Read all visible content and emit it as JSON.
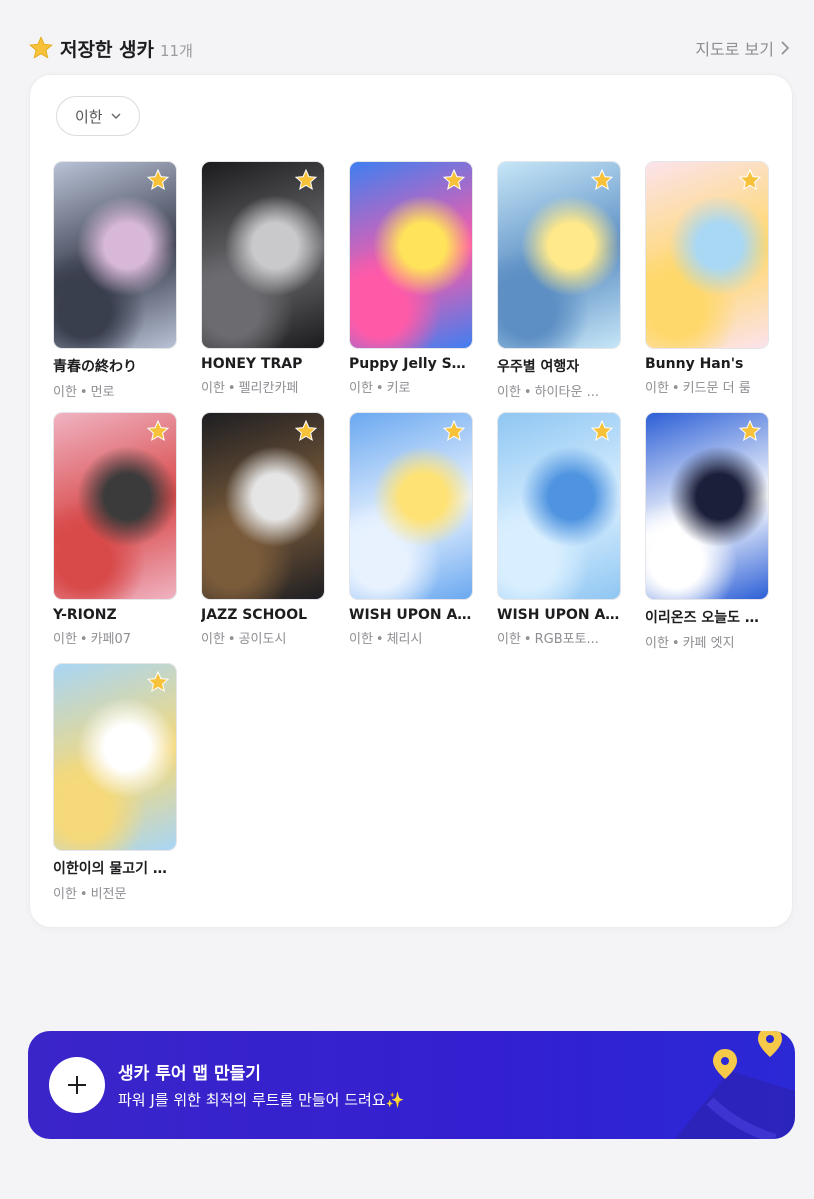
{
  "header": {
    "title": "저장한 생카",
    "count": "11개",
    "map_link": "지도로 보기",
    "icon": "star-icon"
  },
  "filter": {
    "selected": "이한"
  },
  "cards": [
    {
      "title": "青春の終わり",
      "artist": "이한",
      "venue": "먼로",
      "colors": [
        "#b9c2d6",
        "#3a3f4e",
        "#d8b8d8"
      ]
    },
    {
      "title": "HONEY TRAP",
      "artist": "이한",
      "venue": "펠리칸카페",
      "colors": [
        "#1b1b1d",
        "#6c6c70",
        "#c9c9cc"
      ]
    },
    {
      "title": "Puppy Jelly Shop",
      "artist": "이한",
      "venue": "키로",
      "colors": [
        "#3f7ff0",
        "#ff5aa8",
        "#ffe35a"
      ]
    },
    {
      "title": "우주별 여행자",
      "artist": "이한",
      "venue": "하이타운 ...",
      "colors": [
        "#c6e6f7",
        "#5d8fc4",
        "#ffe98a"
      ]
    },
    {
      "title": "Bunny Han's",
      "artist": "이한",
      "venue": "키드문 더 룸",
      "colors": [
        "#fbe3ec",
        "#ffd86b",
        "#a9d8f5"
      ]
    },
    {
      "title": "Y-RIONZ",
      "artist": "이한",
      "venue": "카페07",
      "colors": [
        "#f0b3c2",
        "#d84a4a",
        "#3b3b3b"
      ]
    },
    {
      "title": "JAZZ SCHOOL",
      "artist": "이한",
      "venue": "공이도시",
      "colors": [
        "#1e1e22",
        "#7a5b3a",
        "#e5e5e5"
      ]
    },
    {
      "title": "WISH UPON A S...",
      "artist": "이한",
      "venue": "체리시",
      "colors": [
        "#6aa8f0",
        "#e8f2ff",
        "#ffe274"
      ]
    },
    {
      "title": "WISH UPON A S...",
      "artist": "이한",
      "venue": "RGB포토...",
      "colors": [
        "#8fc6f2",
        "#d9efff",
        "#4f94e0"
      ]
    },
    {
      "title": "이리온즈 오늘도 순...",
      "artist": "이한",
      "venue": "카페 엣지",
      "colors": [
        "#2c5fd6",
        "#ffffff",
        "#1b1f3a"
      ]
    },
    {
      "title": "이한이의 물고기 동...",
      "artist": "이한",
      "venue": "비전문",
      "colors": [
        "#a8d5f5",
        "#f5d97a",
        "#ffffff"
      ]
    }
  ],
  "banner": {
    "title": "생카 투어 맵 만들기",
    "subtitle": "파워 J를 위한 최적의 루트를 만들어 드려요✨",
    "bg": "#3a25c9",
    "accent": "#f7c948"
  },
  "colors": {
    "star": "#f7c23a",
    "muted": "#8e8e93"
  }
}
